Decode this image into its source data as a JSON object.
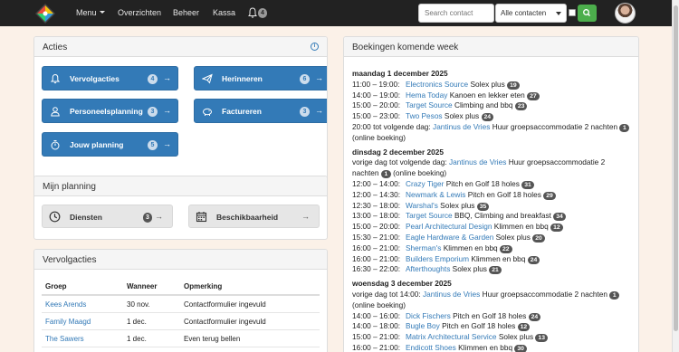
{
  "navbar": {
    "menu_label": "Menu",
    "overzichten_label": "Overzichten",
    "beheer_label": "Beheer",
    "kassa_label": "Kassa",
    "notifications_count": "4",
    "search_placeholder": "Search contact",
    "filter_selected": "Alle contacten",
    "colors": {
      "bar": "#222222",
      "search_button": "#4cae4c"
    }
  },
  "acties": {
    "title": "Acties",
    "buttons": [
      {
        "label": "Vervolgacties",
        "count": "4",
        "icon": "bell-icon"
      },
      {
        "label": "Herinneren",
        "count": "6",
        "icon": "paper-plane-icon"
      },
      {
        "label": "Personeelsplanning",
        "count": "3",
        "icon": "user-icon"
      },
      {
        "label": "Factureren",
        "count": "3",
        "icon": "piggy-bank-icon"
      },
      {
        "label": "Jouw planning",
        "count": "5",
        "icon": "stopwatch-icon"
      }
    ],
    "arrow": "→"
  },
  "planning": {
    "title": "Mijn planning",
    "diensten_label": "Diensten",
    "diensten_count": "3",
    "beschikbaarheid_label": "Beschikbaarheid",
    "arrow": "→"
  },
  "vervolgacties": {
    "title": "Vervolgacties",
    "columns": [
      "Groep",
      "Wanneer",
      "Opmerking"
    ],
    "rows": [
      {
        "groep": "Kees Arends",
        "wanneer": "30 nov.",
        "opmerking": "Contactformulier ingevuld"
      },
      {
        "groep": "Family Maagd",
        "wanneer": "1 dec.",
        "opmerking": "Contactformulier ingevuld"
      },
      {
        "groep": "The Sawers",
        "wanneer": "1 dec.",
        "opmerking": "Even terug bellen"
      }
    ]
  },
  "bookings": {
    "title": "Boekingen komende week",
    "days": [
      {
        "date": "maandag 1 december 2025",
        "items": [
          {
            "time": "11:00 – 19:00:",
            "name": "Electronics Source",
            "desc": "Solex plus",
            "count": "19"
          },
          {
            "time": "14:00 – 19:00:",
            "name": "Hema Today",
            "desc": "Kanoen en lekker eten",
            "count": "27"
          },
          {
            "time": "15:00 – 20:00:",
            "name": "Target Source",
            "desc": "Climbing and bbq",
            "count": "23"
          },
          {
            "time": "15:00 – 23:00:",
            "name": "Two Pesos",
            "desc": "Solex plus",
            "count": "24"
          },
          {
            "time": "20:00 tot volgende dag:",
            "name": "Jantinus de Vries",
            "desc": "Huur groepsaccommodatie 2 nachten",
            "count": "1",
            "suffix": "(online boeking)"
          }
        ]
      },
      {
        "date": "dinsdag 2 december 2025",
        "items": [
          {
            "time": "vorige dag tot volgende dag:",
            "name": "Jantinus de Vries",
            "desc": "Huur groepsaccommodatie 2 nachten",
            "count": "1",
            "suffix": "(online boeking)"
          },
          {
            "time": "12:00 – 14:00:",
            "name": "Crazy Tiger",
            "desc": "Pitch en Golf 18 holes",
            "count": "31"
          },
          {
            "time": "12:00 – 14:30:",
            "name": "Newmark & Lewis",
            "desc": "Pitch en Golf 18 holes",
            "count": "29"
          },
          {
            "time": "12:30 – 18:00:",
            "name": "Warshal's",
            "desc": "Solex plus",
            "count": "35"
          },
          {
            "time": "13:00 – 18:00:",
            "name": "Target Source",
            "desc": "BBQ, Climbing and breakfast",
            "count": "34"
          },
          {
            "time": "15:00 – 20:00:",
            "name": "Pearl Architectural Design",
            "desc": "Klimmen en bbq",
            "count": "12"
          },
          {
            "time": "15:30 – 21:00:",
            "name": "Eagle Hardware & Garden",
            "desc": "Solex plus",
            "count": "20"
          },
          {
            "time": "16:00 – 21:00:",
            "name": "Sherman's",
            "desc": "Klimmen en bbq",
            "count": "22"
          },
          {
            "time": "16:00 – 21:00:",
            "name": "Builders Emporium",
            "desc": "Klimmen en bbq",
            "count": "24"
          },
          {
            "time": "16:30 – 22:00:",
            "name": "Afterthoughts",
            "desc": "Solex plus",
            "count": "21"
          }
        ]
      },
      {
        "date": "woensdag 3 december 2025",
        "items": [
          {
            "time": "vorige dag tot 14:00:",
            "name": "Jantinus de Vries",
            "desc": "Huur groepsaccommodatie 2 nachten",
            "count": "1",
            "suffix": "(online boeking)"
          },
          {
            "time": "14:00 – 16:00:",
            "name": "Dick Fischers",
            "desc": "Pitch en Golf 18 holes",
            "count": "24"
          },
          {
            "time": "14:00 – 18:00:",
            "name": "Bugle Boy",
            "desc": "Pitch en Golf 18 holes",
            "count": "12"
          },
          {
            "time": "15:00 – 21:00:",
            "name": "Matrix Architectural Service",
            "desc": "Solex plus",
            "count": "13"
          },
          {
            "time": "16:00 – 21:00:",
            "name": "Endicott Shoes",
            "desc": "Klimmen en bbq",
            "count": "30"
          }
        ]
      }
    ]
  }
}
